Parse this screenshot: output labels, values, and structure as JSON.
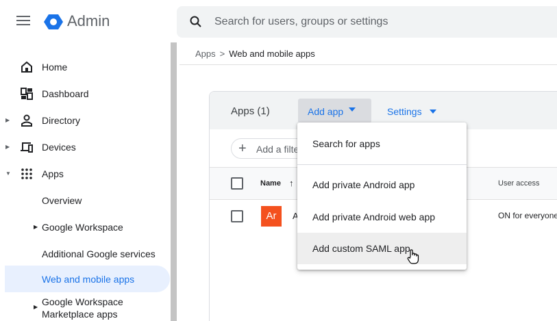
{
  "header": {
    "brand": "Admin",
    "search_placeholder": "Search for users, groups or settings",
    "brand_colors": {
      "logo": "#1a73e8",
      "accent": "#1a73e8"
    }
  },
  "sidebar": {
    "items": [
      {
        "label": "Home",
        "icon": "home-icon"
      },
      {
        "label": "Dashboard",
        "icon": "dashboard-icon"
      },
      {
        "label": "Directory",
        "icon": "person-icon",
        "expandable": true
      },
      {
        "label": "Devices",
        "icon": "devices-icon",
        "expandable": true
      },
      {
        "label": "Apps",
        "icon": "apps-grid-icon",
        "expanded": true
      },
      {
        "label": "Overview"
      },
      {
        "label": "Google Workspace",
        "expandable": true
      },
      {
        "label": "Additional Google services"
      },
      {
        "label": "Web and mobile apps",
        "selected": true
      },
      {
        "label": "Google Workspace\nMarketplace apps",
        "expandable": true
      }
    ]
  },
  "breadcrumb": {
    "root": "Apps",
    "separator": ">",
    "current": "Web and mobile apps"
  },
  "apps_panel": {
    "count_label": "Apps (1)",
    "add_app_label": "Add app",
    "settings_label": "Settings",
    "filter_label": "Add a filter",
    "columns": {
      "name": "Name",
      "sort_indicator": "↑",
      "user_access": "User access"
    },
    "rows": [
      {
        "avatar_text": "Ar",
        "avatar_color": "#f4511e",
        "name": "A",
        "user_access": "ON for everyone"
      }
    ]
  },
  "add_app_menu": {
    "items": [
      {
        "label": "Search for apps"
      },
      {
        "label": "Add private Android app"
      },
      {
        "label": "Add private Android web app"
      },
      {
        "label": "Add custom SAML app",
        "hovered": true
      }
    ]
  }
}
